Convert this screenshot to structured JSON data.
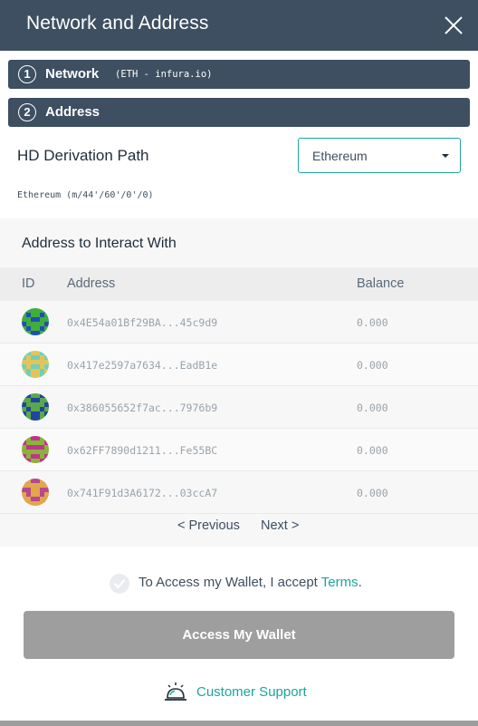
{
  "header": {
    "title": "Network and Address",
    "close_icon": "close-icon"
  },
  "steps": [
    {
      "num": "1",
      "label": "Network",
      "sub": "(ETH - infura.io)"
    },
    {
      "num": "2",
      "label": "Address",
      "sub": ""
    }
  ],
  "derivation": {
    "label": "HD Derivation Path",
    "selected": "Ethereum",
    "path_note": "Ethereum (m/44'/60'/0'/0)"
  },
  "address_panel": {
    "title": "Address to Interact With",
    "columns": [
      "ID",
      "Address",
      "Balance"
    ],
    "rows": [
      {
        "address": "0x4E54a01Bf29BA...45c9d9",
        "balance": "0.000",
        "avatar_colors": [
          "#1f4fb5",
          "#3fae3b"
        ]
      },
      {
        "address": "0x417e2597a7634...EadB1e",
        "balance": "0.000",
        "avatar_colors": [
          "#6fd0b8",
          "#e4c45a"
        ]
      },
      {
        "address": "0x386055652f7ac...7976b9",
        "balance": "0.000",
        "avatar_colors": [
          "#21459f",
          "#5aa84a"
        ]
      },
      {
        "address": "0x62FF7890d1211...Fe55BC",
        "balance": "0.000",
        "avatar_colors": [
          "#c0358c",
          "#8bb33a"
        ]
      },
      {
        "address": "0x741F91d3A6172...03ccA7",
        "balance": "0.000",
        "avatar_colors": [
          "#b8488f",
          "#e0a84a"
        ]
      }
    ],
    "prev_label": "< Previous",
    "next_label": "Next >"
  },
  "accept": {
    "text": "To Access my Wallet, I accept ",
    "link": "Terms",
    "suffix": "."
  },
  "access_button": "Access My Wallet",
  "support": {
    "label": "Customer Support",
    "icon": "bell-icon"
  },
  "colors": {
    "header": "#3d4f61",
    "accent": "#1ca69a",
    "button_disabled": "#9e9e9e"
  }
}
